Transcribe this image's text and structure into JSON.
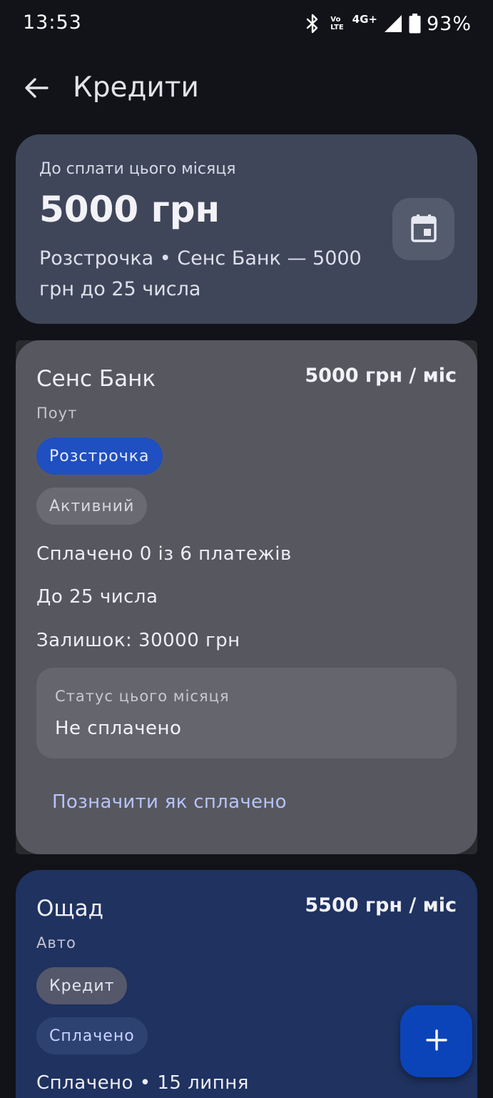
{
  "status_bar": {
    "time": "13:53",
    "volte_top": "Vo",
    "volte_bottom": "LTE",
    "network": "4G+",
    "battery": "93%",
    "icons": [
      "bluetooth-icon",
      "volte-icon",
      "signal-icon",
      "battery-icon"
    ]
  },
  "app_bar": {
    "back_icon": "arrow-back-icon",
    "title": "Кредити"
  },
  "summary": {
    "label": "До сплати цього місяця",
    "amount": "5000 грн",
    "detail": "Розстрочка • Сенс Банк — 5000 грн до 25 числа",
    "calendar_icon": "calendar-today-icon"
  },
  "loans": [
    {
      "bank": "Сенс Банк",
      "monthly": "5000 грн / міс",
      "subtitle": "Поут",
      "type_chip": "Розстрочка",
      "state_chip": "Активний",
      "progress": "Сплачено 0 із 6 платежів",
      "due": "До 25 числа",
      "remaining": "Залишок: 30000 грн",
      "status_label": "Статус цього місяця",
      "status_value": "Не сплачено",
      "action": "Позначити як сплачено",
      "color": "#57585f"
    },
    {
      "bank": "Ощад",
      "monthly": "5500 грн / міс",
      "subtitle": "Авто",
      "type_chip": "Кредит",
      "state_chip": "Сплачено",
      "progress": "Сплачено • 15 липня",
      "color": "#1f3260"
    }
  ],
  "fab": {
    "icon": "add-icon",
    "color": "#0b44b8"
  },
  "colors": {
    "background": "#111318",
    "summary_card": "#3f4659",
    "accent_chip": "#1f4fc0",
    "link": "#b7c3ff"
  }
}
